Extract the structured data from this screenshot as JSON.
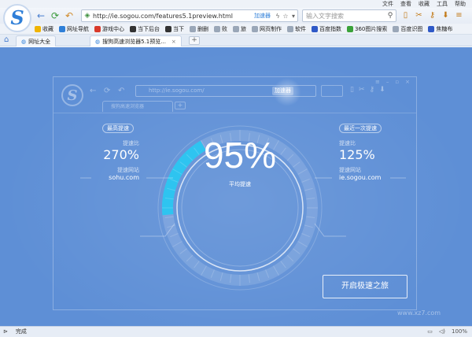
{
  "menu": {
    "items": [
      "文件",
      "查看",
      "收藏",
      "工具",
      "帮助"
    ]
  },
  "toolbar": {
    "logo_letter": "S",
    "back_label": "←",
    "refresh_label": "⟳",
    "undo_label": "↶",
    "address_url": "http://ie.sogou.com/features5.1preview.html",
    "address_accel": "加速器",
    "search_placeholder": "输入文字搜索"
  },
  "bookmarks": [
    {
      "label": "收藏",
      "color": "#f0b400"
    },
    {
      "label": "网址导航",
      "color": "#2f7fd8"
    },
    {
      "label": "游戏中心",
      "color": "#d93a2b"
    },
    {
      "label": "当下后台",
      "color": "#333333"
    },
    {
      "label": "当下",
      "color": "#333333"
    },
    {
      "label": "删删",
      "color": "#9aa7b8"
    },
    {
      "label": "败",
      "color": "#9aa7b8"
    },
    {
      "label": "旅",
      "color": "#9aa7b8"
    },
    {
      "label": "网页制作",
      "color": "#9aa7b8"
    },
    {
      "label": "软件",
      "color": "#9aa7b8"
    },
    {
      "label": "百度指数",
      "color": "#2f59c7"
    },
    {
      "label": "360图片搜索",
      "color": "#3aa23a"
    },
    {
      "label": "百度识图",
      "color": "#9aa7b8"
    },
    {
      "label": "焦糖布",
      "color": "#2f59c7"
    }
  ],
  "tabs": [
    {
      "label": "网址大全"
    },
    {
      "label": "搜狗高速浏览器5.1预览..."
    }
  ],
  "mock": {
    "logo_letter": "S",
    "url": "http://ie.sogou.com/",
    "accel": "加速器",
    "tab_label": "搜狗高速浏览器",
    "new_tab": "+"
  },
  "stats": {
    "left": {
      "tag": "最高提速",
      "ratio_label": "提速比",
      "ratio": "270%",
      "site_label": "提速网站",
      "site": "sohu.com"
    },
    "right": {
      "tag": "最近一次提速",
      "ratio_label": "提速比",
      "ratio": "125%",
      "site_label": "提速网站",
      "site": "ie.sogou.com"
    },
    "center_value": "95%",
    "center_label": "平均提速",
    "gauge_progress": 0.24
  },
  "cta_label": "开启极速之旅",
  "watermark": "www.xz7.com",
  "status": {
    "text": "完成",
    "zoom": "100%"
  },
  "colors": {
    "page_bg": "#5e8fd6",
    "gauge_arc": "#2ec4f0",
    "accent": "#2f7fd8"
  }
}
